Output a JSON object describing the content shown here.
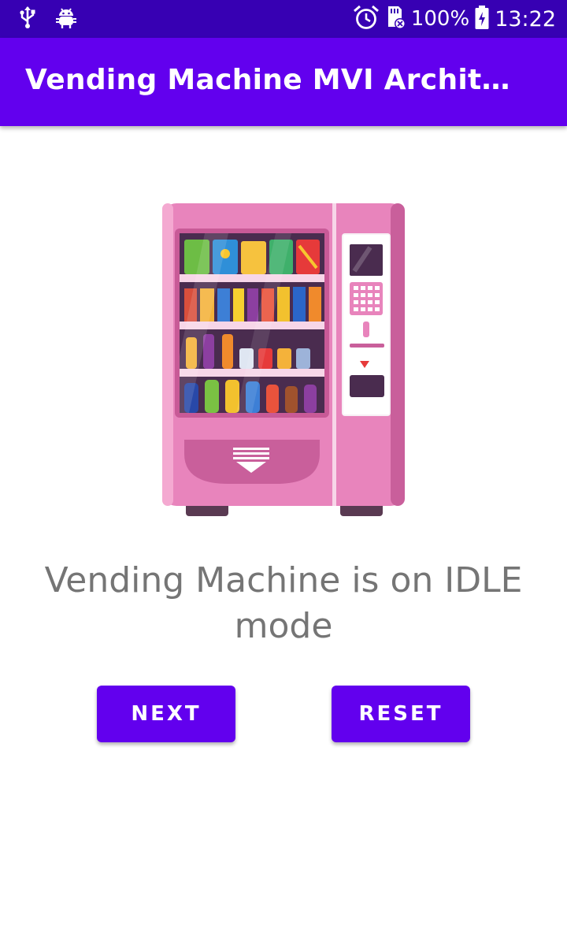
{
  "status_bar": {
    "battery_percent": "100%",
    "time": "13:22",
    "icons": [
      "usb-icon",
      "android-debug-icon",
      "alarm-icon",
      "sd-card-icon",
      "battery-charging-icon"
    ]
  },
  "app_bar": {
    "title": "Vending Machine MVI Architecture"
  },
  "main": {
    "image_name": "vending-machine-illustration",
    "message": "Vending Machine is on IDLE mode"
  },
  "actions": {
    "next_label": "NEXT",
    "reset_label": "RESET"
  },
  "colors": {
    "primary": "#6200ee",
    "primary_dark": "#3700b3",
    "message_text": "#757575",
    "machine_body": "#e884bc"
  }
}
